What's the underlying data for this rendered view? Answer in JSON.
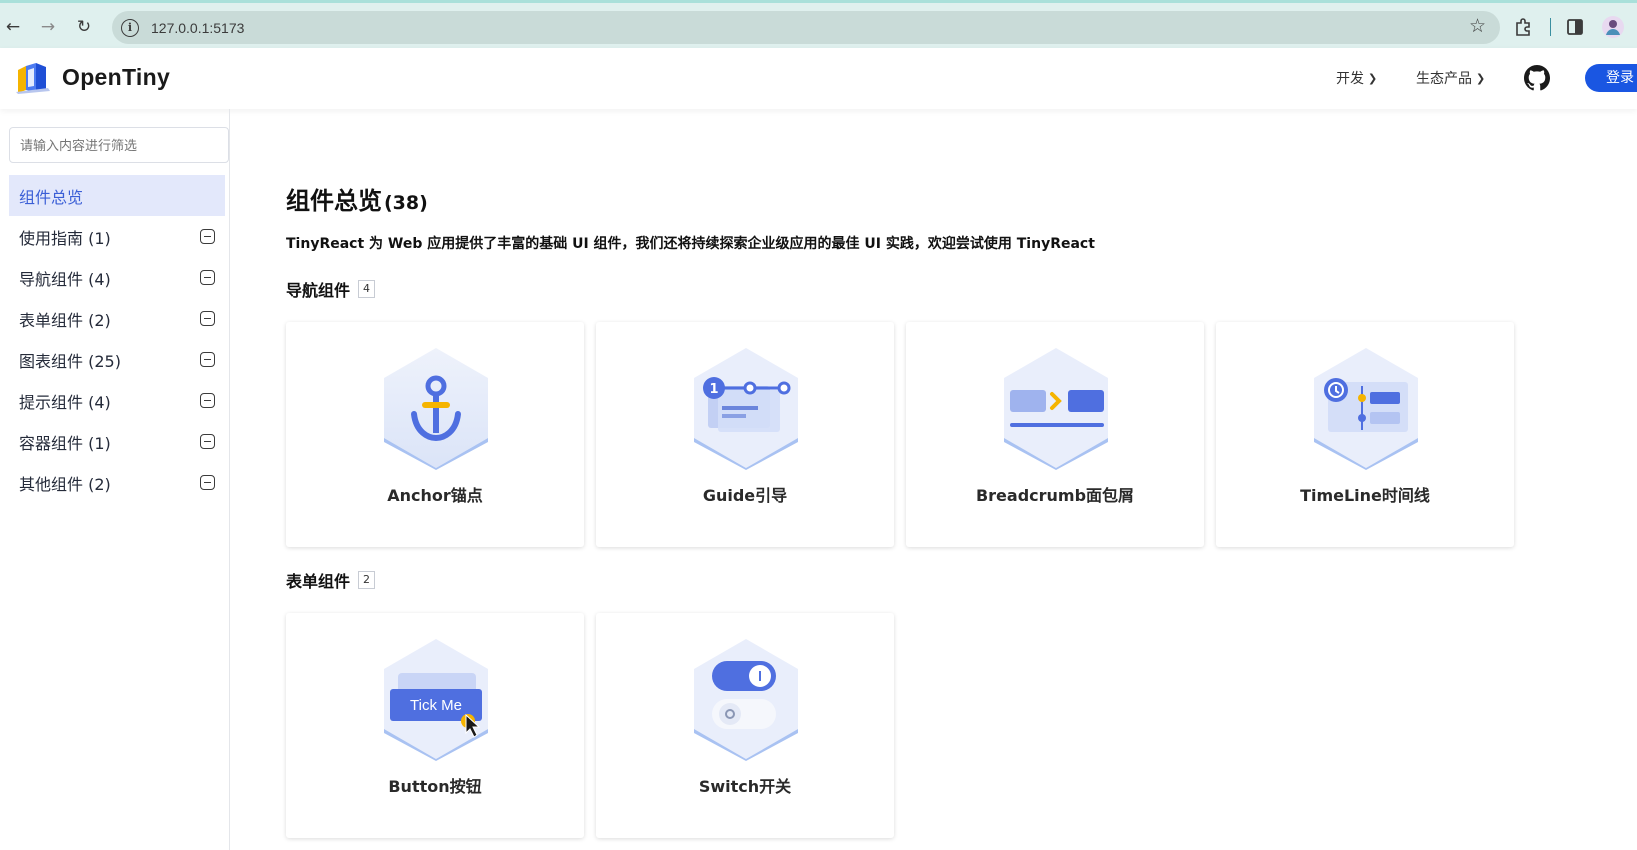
{
  "browser": {
    "url": "127.0.0.1:5173",
    "icons": [
      "back-icon",
      "forward-icon",
      "reload-icon",
      "site-info-icon",
      "bookmark-star-icon",
      "extensions-icon",
      "side-panel-icon",
      "profile-icon"
    ]
  },
  "header": {
    "logo_text": "OpenTiny",
    "nav": [
      {
        "label": "开发"
      },
      {
        "label": "生态产品"
      }
    ],
    "login_label": "登录",
    "brand_color": "#1a56e2"
  },
  "sidebar": {
    "filter_placeholder": "请输入内容进行筛选",
    "items": [
      {
        "label": "组件总览",
        "active": true
      },
      {
        "label": "使用指南 (1)"
      },
      {
        "label": "导航组件 (4)"
      },
      {
        "label": "表单组件 (2)"
      },
      {
        "label": "图表组件 (25)"
      },
      {
        "label": "提示组件 (4)"
      },
      {
        "label": "容器组件 (1)"
      },
      {
        "label": "其他组件 (2)"
      }
    ]
  },
  "main": {
    "title": "组件总览",
    "title_count": "(38)",
    "intro": "TinyReact 为 Web 应用提供了丰富的基础 UI 组件，我们还将持续探索企业级应用的最佳 UI 实践，欢迎尝试使用 TinyReact",
    "sections": [
      {
        "title": "导航组件",
        "count": "4",
        "cards": [
          {
            "name": "Anchor锚点",
            "icon": "anchor-icon"
          },
          {
            "name": "Guide引导",
            "icon": "guide-steps-icon"
          },
          {
            "name": "Breadcrumb面包屑",
            "icon": "breadcrumb-icon"
          },
          {
            "name": "TimeLine时间线",
            "icon": "timeline-icon"
          }
        ]
      },
      {
        "title": "表单组件",
        "count": "2",
        "cards": [
          {
            "name": "Button按钮",
            "icon": "button-icon",
            "art_text": "Tick Me"
          },
          {
            "name": "Switch开关",
            "icon": "switch-icon"
          }
        ]
      }
    ]
  }
}
